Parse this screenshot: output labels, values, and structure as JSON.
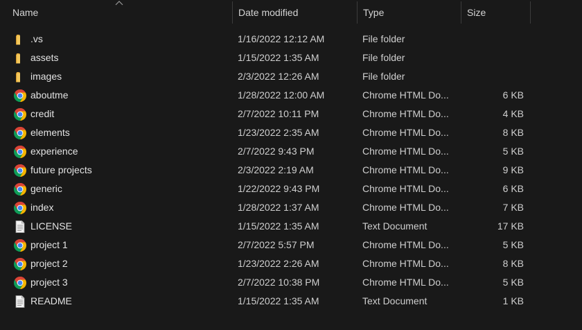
{
  "columns": {
    "name": "Name",
    "date": "Date modified",
    "type": "Type",
    "size": "Size"
  },
  "sort": {
    "column": "name",
    "direction": "ascending",
    "icon": "sort-up-icon"
  },
  "files": [
    {
      "name": ".vs",
      "date": "1/16/2022 12:12 AM",
      "type": "File folder",
      "size": "",
      "icon": "folder-icon"
    },
    {
      "name": "assets",
      "date": "1/15/2022 1:35 AM",
      "type": "File folder",
      "size": "",
      "icon": "folder-icon"
    },
    {
      "name": "images",
      "date": "2/3/2022 12:26 AM",
      "type": "File folder",
      "size": "",
      "icon": "folder-icon"
    },
    {
      "name": "aboutme",
      "date": "1/28/2022 12:00 AM",
      "type": "Chrome HTML Do...",
      "size": "6 KB",
      "icon": "chrome-icon"
    },
    {
      "name": "credit",
      "date": "2/7/2022 10:11 PM",
      "type": "Chrome HTML Do...",
      "size": "4 KB",
      "icon": "chrome-icon"
    },
    {
      "name": "elements",
      "date": "1/23/2022 2:35 AM",
      "type": "Chrome HTML Do...",
      "size": "8 KB",
      "icon": "chrome-icon"
    },
    {
      "name": "experience",
      "date": "2/7/2022 9:43 PM",
      "type": "Chrome HTML Do...",
      "size": "5 KB",
      "icon": "chrome-icon"
    },
    {
      "name": "future projects",
      "date": "2/3/2022 2:19 AM",
      "type": "Chrome HTML Do...",
      "size": "9 KB",
      "icon": "chrome-icon"
    },
    {
      "name": "generic",
      "date": "1/22/2022 9:43 PM",
      "type": "Chrome HTML Do...",
      "size": "6 KB",
      "icon": "chrome-icon"
    },
    {
      "name": "index",
      "date": "1/28/2022 1:37 AM",
      "type": "Chrome HTML Do...",
      "size": "7 KB",
      "icon": "chrome-icon"
    },
    {
      "name": "LICENSE",
      "date": "1/15/2022 1:35 AM",
      "type": "Text Document",
      "size": "17 KB",
      "icon": "text-document-icon"
    },
    {
      "name": "project 1",
      "date": "2/7/2022 5:57 PM",
      "type": "Chrome HTML Do...",
      "size": "5 KB",
      "icon": "chrome-icon"
    },
    {
      "name": "project 2",
      "date": "1/23/2022 2:26 AM",
      "type": "Chrome HTML Do...",
      "size": "8 KB",
      "icon": "chrome-icon"
    },
    {
      "name": "project 3",
      "date": "2/7/2022 10:38 PM",
      "type": "Chrome HTML Do...",
      "size": "5 KB",
      "icon": "chrome-icon"
    },
    {
      "name": "README",
      "date": "1/15/2022 1:35 AM",
      "type": "Text Document",
      "size": "1 KB",
      "icon": "text-document-icon"
    }
  ],
  "colors": {
    "background": "#191919",
    "folder": "#f4c85c",
    "chrome_red": "#db4437",
    "chrome_yellow": "#f4b400",
    "chrome_green": "#0f9d58",
    "chrome_blue": "#4285f4"
  }
}
